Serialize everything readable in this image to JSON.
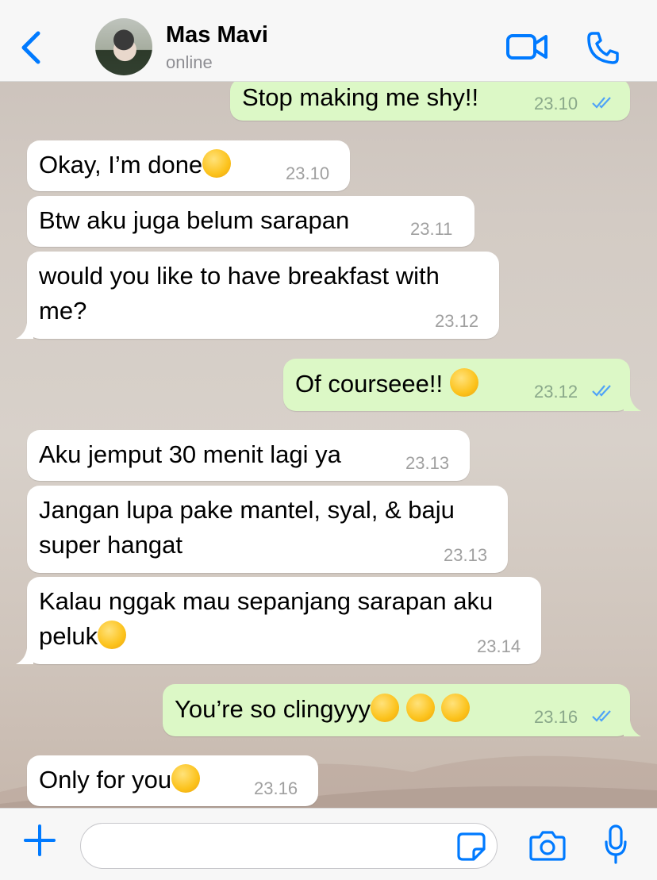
{
  "header": {
    "contact_name": "Mas Mavi",
    "status": "online"
  },
  "messages": [
    {
      "direction": "out",
      "text": "Stop making me shy!!",
      "time": "23.10",
      "read": true
    },
    {
      "direction": "in",
      "text": "Okay, I’m done",
      "emoji": [
        "sweat-smile-emoji"
      ],
      "time": "23.10"
    },
    {
      "direction": "in",
      "text": "Btw aku juga belum sarapan",
      "time": "23.11"
    },
    {
      "direction": "in",
      "text": "would you like to have breakfast with\nme?",
      "time": "23.12"
    },
    {
      "direction": "out",
      "text": "Of courseee!! ",
      "emoji": [
        "laughing-emoji"
      ],
      "time": "23.12",
      "read": true
    },
    {
      "direction": "in",
      "text": "Aku jemput 30 menit lagi ya",
      "time": "23.13"
    },
    {
      "direction": "in",
      "text": "Jangan lupa pake mantel, syal, & baju\nsuper hangat",
      "time": "23.13"
    },
    {
      "direction": "in",
      "text": "Kalau nggak mau sepanjang sarapan aku\npeluk",
      "emoji": [
        "kissing-emoji"
      ],
      "time": "23.14"
    },
    {
      "direction": "out",
      "text": "You’re so clingyyy",
      "emoji": [
        "face-peeking-emoji",
        "face-peeking-emoji",
        "face-peeking-emoji"
      ],
      "time": "23.16",
      "read": true
    },
    {
      "direction": "in",
      "text": "Only for you",
      "emoji": [
        "winking-emoji"
      ],
      "time": "23.16"
    }
  ],
  "composer": {
    "value": "",
    "placeholder": ""
  },
  "colors": {
    "accent": "#007aff",
    "incoming_bubble": "#ffffff",
    "outgoing_bubble": "#dcf8c6",
    "read_ticks": "#4fa3f7"
  },
  "icons": {
    "back": "chevron-left-icon",
    "video": "video-camera-icon",
    "call": "phone-icon",
    "attach": "plus-icon",
    "sticker": "sticker-icon",
    "camera": "camera-icon",
    "mic": "microphone-icon"
  }
}
